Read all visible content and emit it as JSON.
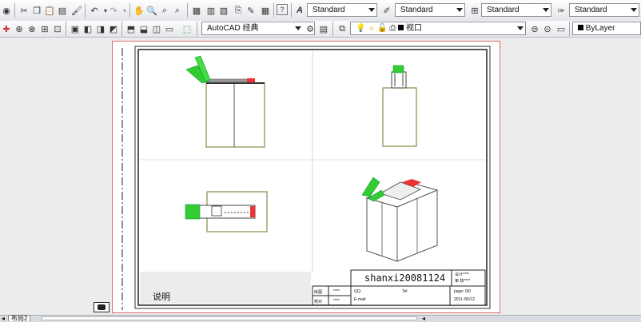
{
  "toolbar_top": {
    "icons": [
      "help-icon",
      "cut-icon",
      "copy-icon",
      "paste-icon",
      "match-properties-icon",
      "paint-icon",
      "undo-icon",
      "redo-icon",
      "pan-icon",
      "zoom-realtime-icon",
      "zoom-window-icon",
      "zoom-previous-icon",
      "properties-icon",
      "design-center-icon",
      "tool-palettes-icon",
      "sheet-set-icon",
      "markup-icon",
      "calculator-icon",
      "help-question-icon"
    ],
    "text_style": "Standard",
    "dim_style": "Standard",
    "table_style": "Standard",
    "mleader_style": "Standard"
  },
  "toolbar_bottom": {
    "workspace": "AutoCAD 经典",
    "layer": "视口",
    "color": "ByLayer"
  },
  "drawing": {
    "title_block": {
      "drawing_name": "shanxi20081124",
      "notes_label": "说明",
      "designer_label": "设计****",
      "reviewer_label": "审 核****",
      "qq_label": "QQ:",
      "tel_label": "Tel:",
      "email_label": "E-mail:",
      "page_label": "page: 0/0",
      "date": "2011 /06/12",
      "row1_a": "绘图",
      "row1_b": "****",
      "row2_a": "校对",
      "row2_b": "****"
    }
  },
  "status": {
    "layout_tab": "布局2"
  }
}
